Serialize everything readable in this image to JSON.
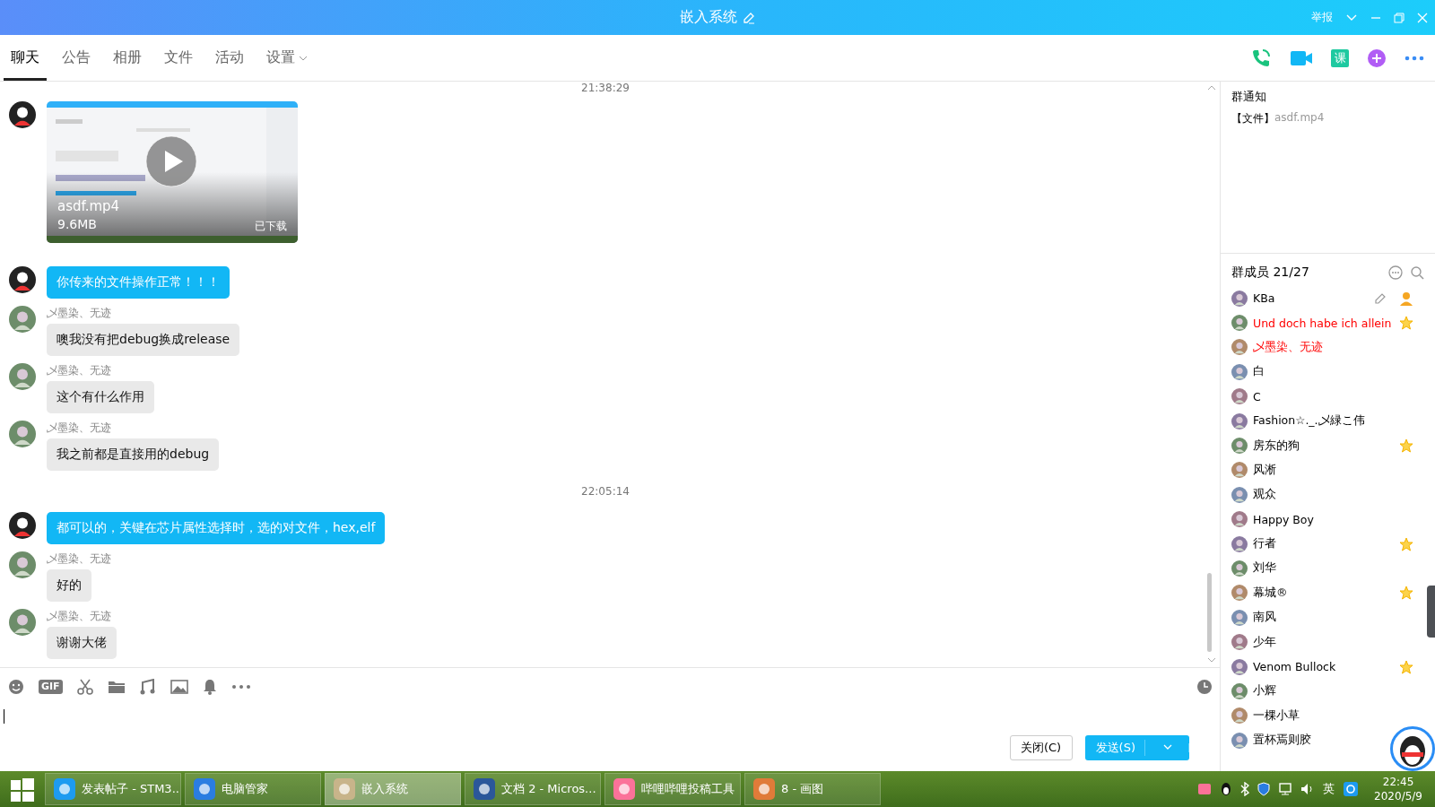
{
  "window": {
    "title": "嵌入系统",
    "report": "举报"
  },
  "tabs": [
    {
      "label": "聊天",
      "selected": true
    },
    {
      "label": "公告",
      "selected": false
    },
    {
      "label": "相册",
      "selected": false
    },
    {
      "label": "文件",
      "selected": false
    },
    {
      "label": "活动",
      "selected": false
    },
    {
      "label": "设置",
      "selected": false,
      "dropdown": true
    }
  ],
  "toolbar": {
    "course_label": "课"
  },
  "messages": [
    {
      "kind": "time",
      "text": "21:38:29"
    },
    {
      "kind": "video",
      "file": "asdf.mp4",
      "size": "9.6MB",
      "status": "已下载"
    },
    {
      "kind": "text",
      "own": true,
      "text": "你传来的文件操作正常！！！"
    },
    {
      "kind": "text",
      "own": false,
      "sender": "乄墨染、无迹",
      "text": "噢我没有把debug换成release"
    },
    {
      "kind": "text",
      "own": false,
      "sender": "乄墨染、无迹",
      "text": "这个有什么作用"
    },
    {
      "kind": "text",
      "own": false,
      "sender": "乄墨染、无迹",
      "text": "我之前都是直接用的debug"
    },
    {
      "kind": "time",
      "text": "22:05:14"
    },
    {
      "kind": "text",
      "own": true,
      "text": "都可以的，关键在芯片属性选择时，选的对文件，hex,elf"
    },
    {
      "kind": "text",
      "own": false,
      "sender": "乄墨染、无迹",
      "text": "好的"
    },
    {
      "kind": "text",
      "own": false,
      "sender": "乄墨染、无迹",
      "text": "谢谢大佬"
    }
  ],
  "input_toolbar": {
    "gif_label": "GIF"
  },
  "buttons": {
    "close": "关闭(C)",
    "send": "发送(S)"
  },
  "notice": {
    "title": "群通知",
    "tag": "【文件】",
    "file": "asdf.mp4"
  },
  "members_header": "群成员 21/27",
  "members": [
    {
      "name": "KBa",
      "highlighted": false,
      "starred": false,
      "owner": true
    },
    {
      "name": "Und doch habe ich allein",
      "highlighted": true,
      "starred": true,
      "owner": false
    },
    {
      "name": "乄墨染、无迹",
      "highlighted": true,
      "starred": false,
      "owner": false
    },
    {
      "name": "白",
      "highlighted": false,
      "starred": false,
      "owner": false
    },
    {
      "name": "C",
      "highlighted": false,
      "starred": false,
      "owner": false
    },
    {
      "name": "Fashion☆._.乄緑こ伟",
      "highlighted": false,
      "starred": false,
      "owner": false
    },
    {
      "name": "房东的狗",
      "highlighted": false,
      "starred": true,
      "owner": false
    },
    {
      "name": "风淅",
      "highlighted": false,
      "starred": false,
      "owner": false
    },
    {
      "name": "观众",
      "highlighted": false,
      "starred": false,
      "owner": false
    },
    {
      "name": "Happy Boy",
      "highlighted": false,
      "starred": false,
      "owner": false
    },
    {
      "name": "行者",
      "highlighted": false,
      "starred": true,
      "owner": false
    },
    {
      "name": "刘华",
      "highlighted": false,
      "starred": false,
      "owner": false
    },
    {
      "name": "幕城®",
      "highlighted": false,
      "starred": true,
      "owner": false
    },
    {
      "name": "南风",
      "highlighted": false,
      "starred": false,
      "owner": false
    },
    {
      "name": "少年",
      "highlighted": false,
      "starred": false,
      "owner": false
    },
    {
      "name": "Venom Bullock",
      "highlighted": false,
      "starred": true,
      "owner": false
    },
    {
      "name": "小辉",
      "highlighted": false,
      "starred": false,
      "owner": false
    },
    {
      "name": "一棵小草",
      "highlighted": false,
      "starred": false,
      "owner": false
    },
    {
      "name": "置杯焉则胶",
      "highlighted": false,
      "starred": false,
      "owner": false
    }
  ],
  "taskbar": {
    "items": [
      {
        "label": "发表帖子 - STM3...",
        "selected": false
      },
      {
        "label": "电脑管家",
        "selected": false
      },
      {
        "label": "嵌入系统",
        "selected": true
      },
      {
        "label": "文档 2 - Micros...",
        "selected": false
      },
      {
        "label": "哔哩哔哩投稿工具",
        "selected": false
      },
      {
        "label": "8 - 画图",
        "selected": false
      }
    ],
    "ime": "英",
    "time": "22:45",
    "date": "2020/5/9"
  }
}
